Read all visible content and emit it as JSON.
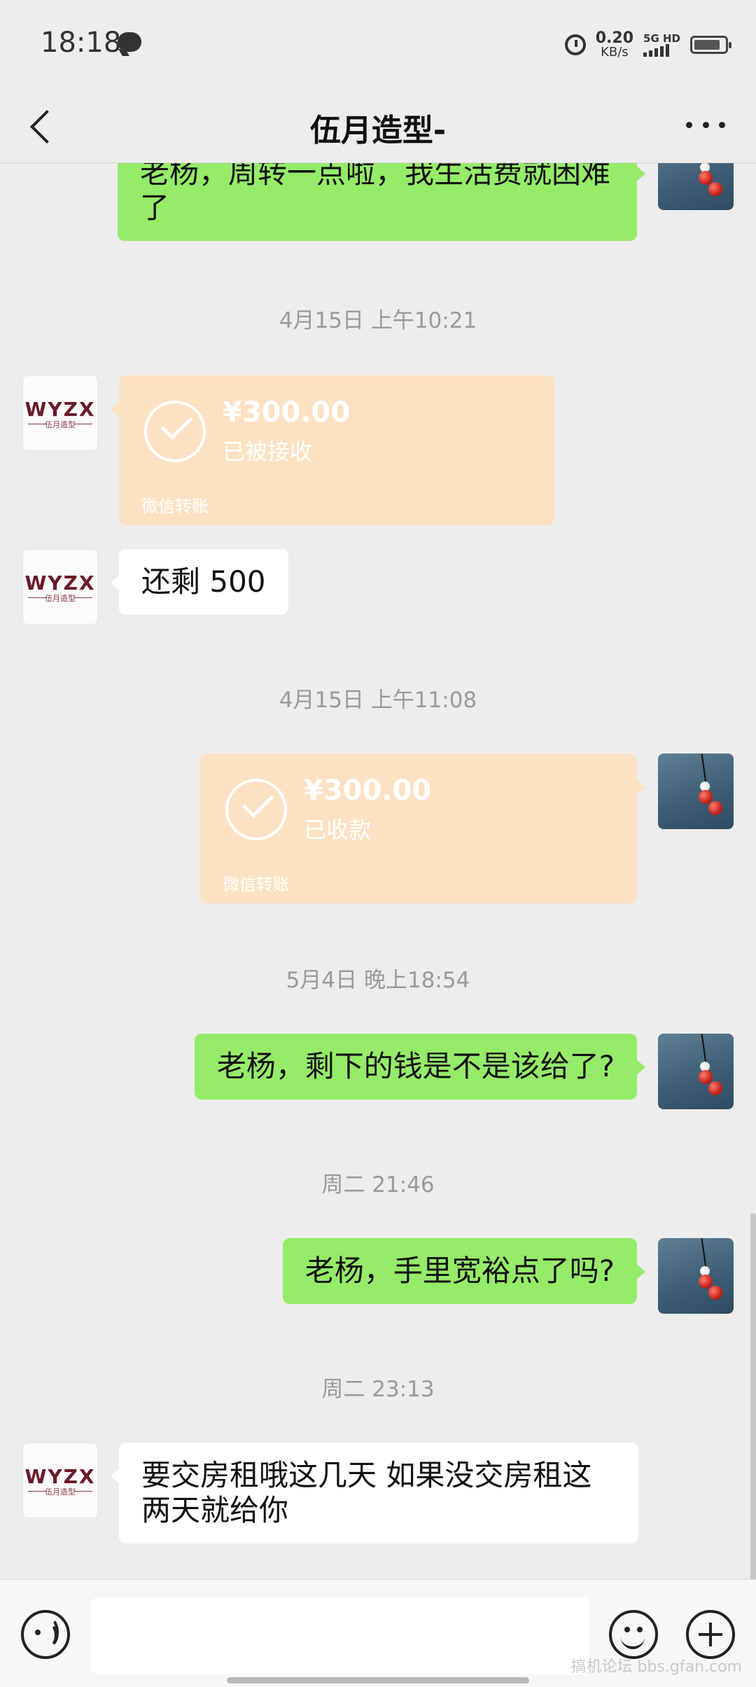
{
  "status_bar": {
    "time": "18:18",
    "speed_value": "0.20",
    "speed_unit": "KB/s",
    "network": "5G HD"
  },
  "header": {
    "title": "伍月造型-"
  },
  "avatars": {
    "contact_logo_text": "WYZX",
    "contact_logo_sub": "伍月造型"
  },
  "messages": {
    "m1_text": "老杨，周转一点啦，我生活费就困难了",
    "ts1": "4月15日 上午10:21",
    "t1_amount": "¥300.00",
    "t1_status": "已被接收",
    "t1_footer": "微信转账",
    "m2_text": "还剩 500",
    "ts2": "4月15日 上午11:08",
    "t2_amount": "¥300.00",
    "t2_status": "已收款",
    "t2_footer": "微信转账",
    "ts3": "5月4日 晚上18:54",
    "m3_text": "老杨，剩下的钱是不是该给了?",
    "ts4": "周二 21:46",
    "m4_text": "老杨，手里宽裕点了吗?",
    "ts5": "周二 23:13",
    "m5_text": "要交房租哦这几天 如果没交房租这两天就给你"
  },
  "input_bar": {
    "watermark": "搞机论坛 bbs.gfan.com"
  },
  "colors": {
    "background": "#ededed",
    "sent_bubble": "#95ec69",
    "received_bubble": "#ffffff",
    "transfer_card": "#fde1c3"
  }
}
